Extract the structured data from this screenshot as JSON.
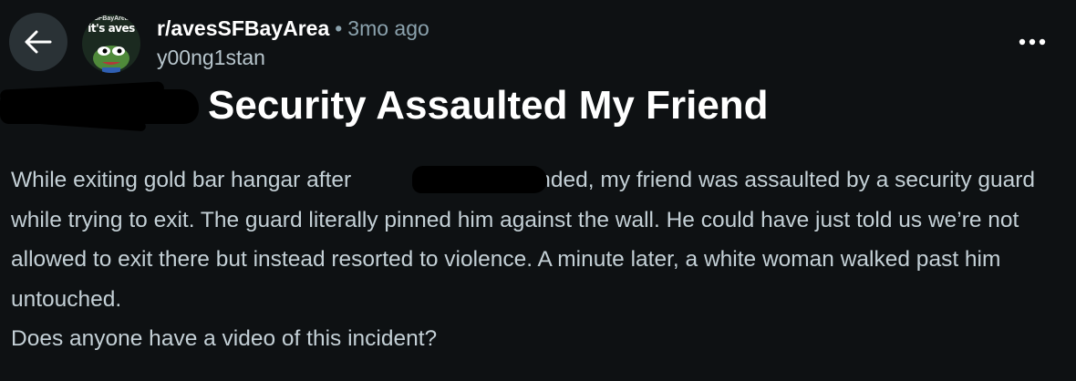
{
  "header": {
    "subreddit": "r/avesSFBayArea",
    "separator": "•",
    "time_ago": "3mo ago",
    "username": "y00ng1stan",
    "avatar_top_text": "SFBayArea",
    "avatar_text": "it's aves"
  },
  "post": {
    "title": "Security Assaulted My Friend",
    "body_line1_a": "While exiting gold bar hangar after",
    "body_line1_b": "set ended, my friend was assaulted by a",
    "body_rest": "security guard while trying to exit. The guard literally pinned him against the wall. He could have just told us we’re not allowed to exit there but instead resorted to violence. A minute later, a white woman walked past him untouched.",
    "paragraph2": "Does anyone have a video of this incident?"
  },
  "icons": {
    "back": "arrow-left-icon",
    "more": "more-horizontal-icon"
  },
  "colors": {
    "background": "#0e1113",
    "back_button_bg": "#2a3236",
    "meta_gray": "#8ba2ad",
    "body_text": "#c4d0d6"
  }
}
